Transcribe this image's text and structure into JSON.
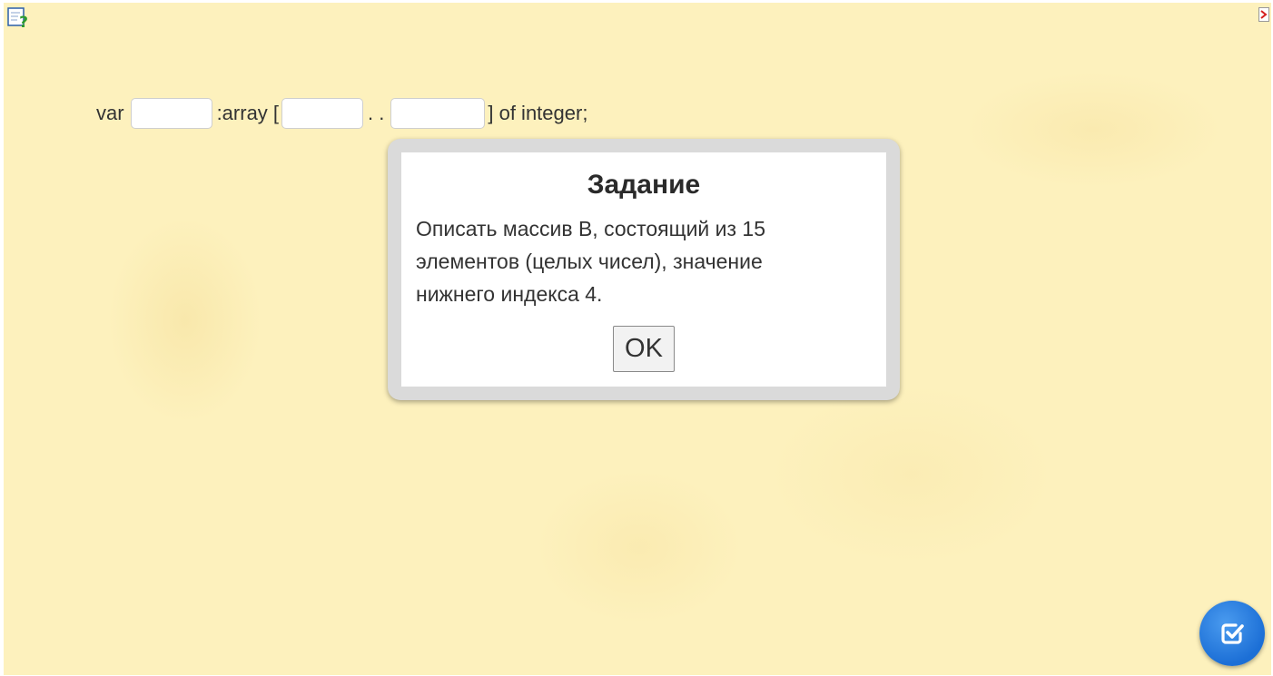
{
  "code_line": {
    "var_kw": "var",
    "array_kw": ":array [",
    "range_sep": ". .",
    "tail": "] of integer;",
    "blank_1_value": "",
    "blank_2_value": "",
    "blank_3_value": ""
  },
  "dialog": {
    "title": "Задание",
    "text": "Описать массив В, состоящий из 15 элементов (целых чисел), значение нижнего индекса 4.",
    "ok_label": "OK"
  },
  "icons": {
    "help": "help-question-icon",
    "corner": "exit-icon",
    "check": "check-square-icon"
  },
  "colors": {
    "background": "#fdf1bd",
    "fab": "#1c6fd6",
    "dialog_frame": "#dadada"
  }
}
